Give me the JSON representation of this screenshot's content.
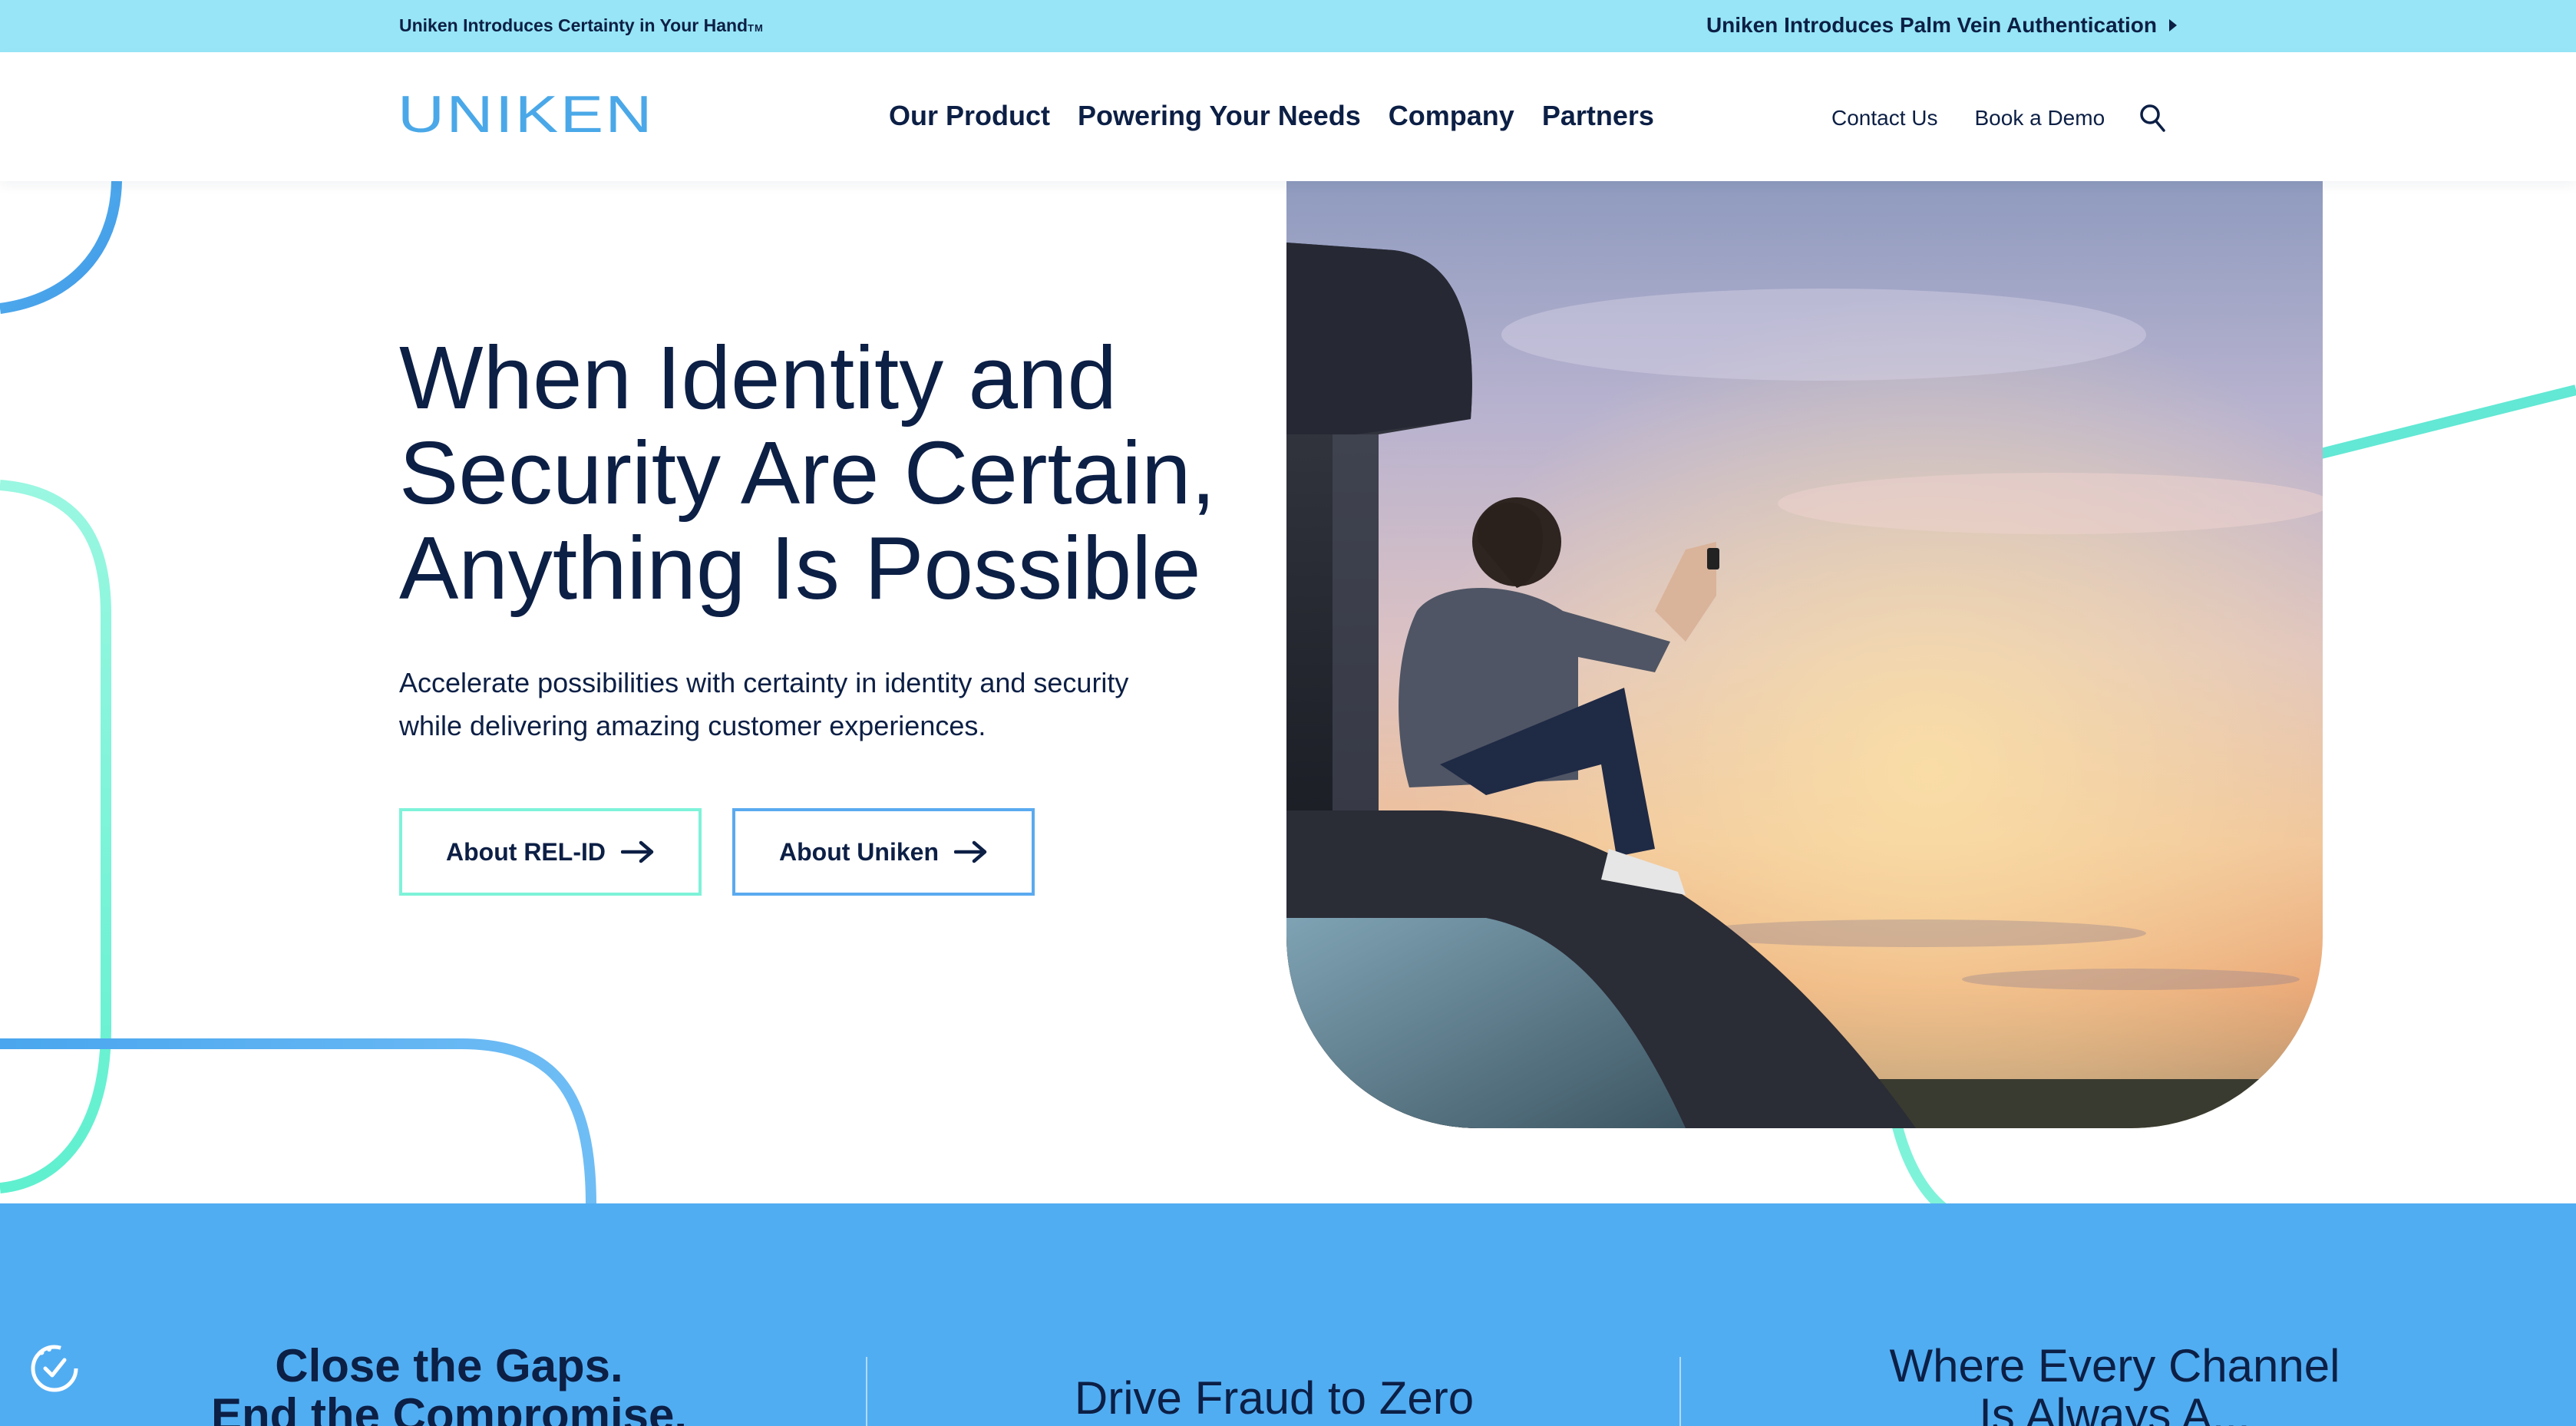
{
  "announcement": {
    "left_text": "Uniken Introduces Certainty in Your Hand",
    "left_tm": "TM",
    "right_link": "Uniken Introduces Palm Vein Authentication"
  },
  "header": {
    "logo_text": "UNIKEN",
    "nav": [
      "Our Product",
      "Powering Your Needs",
      "Company",
      "Partners"
    ],
    "contact": "Contact Us",
    "demo": "Book a Demo"
  },
  "hero": {
    "title_lines": [
      "When Identity and",
      "Security Are Certain,",
      "Anything Is Possible"
    ],
    "subtitle_lines": [
      "Accelerate possibilities with certainty in identity and security",
      "while delivering amazing customer experiences."
    ],
    "buttons": [
      "About REL-ID",
      "About Uniken"
    ]
  },
  "band": {
    "col1_lines": [
      "Close the Gaps.",
      "End the Compromise."
    ],
    "col2": "Drive Fraud to Zero",
    "col3_lines": [
      "Where Every Channel",
      "Is Always A..."
    ]
  },
  "colors": {
    "navy": "#0c1f45",
    "announcement_bg": "#97e5f7",
    "logo_blue": "#4aa8e8",
    "mint": "#7ef3d9",
    "sky": "#5aaaf0",
    "band_bg": "#51adf2"
  }
}
